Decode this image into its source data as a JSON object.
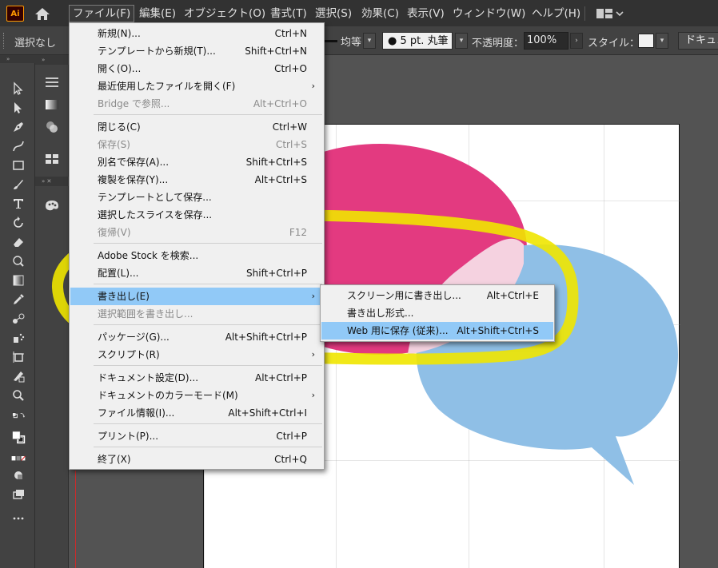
{
  "app": {
    "logo_text": "Ai"
  },
  "menubar": {
    "items": [
      "ファイル(F)",
      "編集(E)",
      "オブジェクト(O)",
      "書式(T)",
      "選択(S)",
      "効果(C)",
      "表示(V)",
      "ウィンドウ(W)",
      "ヘルプ(H)"
    ],
    "workspace_icon": "workspace-switcher-icon"
  },
  "controlbar": {
    "selection_label": "選択なし",
    "stroke_profile": "均等",
    "brush": "● 5 pt. 丸筆",
    "opacity_label": "不透明度：",
    "opacity_value": "100%",
    "style_label": "スタイル：",
    "document_button": "ドキュメ"
  },
  "file_menu": {
    "items": [
      {
        "label": "新規(N)...",
        "shortcut": "Ctrl+N",
        "disabled": false
      },
      {
        "label": "テンプレートから新規(T)...",
        "shortcut": "Shift+Ctrl+N",
        "disabled": false
      },
      {
        "label": "開く(O)...",
        "shortcut": "Ctrl+O",
        "disabled": false
      },
      {
        "label": "最近使用したファイルを開く(F)",
        "shortcut": "",
        "submenu": true,
        "disabled": false
      },
      {
        "label": "Bridge で参照...",
        "shortcut": "Alt+Ctrl+O",
        "disabled": true
      },
      {
        "label": "閉じる(C)",
        "shortcut": "Ctrl+W",
        "disabled": false
      },
      {
        "label": "保存(S)",
        "shortcut": "Ctrl+S",
        "disabled": true
      },
      {
        "label": "別名で保存(A)...",
        "shortcut": "Shift+Ctrl+S",
        "disabled": false
      },
      {
        "label": "複製を保存(Y)...",
        "shortcut": "Alt+Ctrl+S",
        "disabled": false
      },
      {
        "label": "テンプレートとして保存...",
        "shortcut": "",
        "disabled": false
      },
      {
        "label": "選択したスライスを保存...",
        "shortcut": "",
        "disabled": false
      },
      {
        "label": "復帰(V)",
        "shortcut": "F12",
        "disabled": true
      },
      {
        "label": "Adobe Stock を検索...",
        "shortcut": "",
        "disabled": false
      },
      {
        "label": "配置(L)...",
        "shortcut": "Shift+Ctrl+P",
        "disabled": false
      },
      {
        "label": "書き出し(E)",
        "shortcut": "",
        "submenu": true,
        "disabled": false
      },
      {
        "label": "選択範囲を書き出し...",
        "shortcut": "",
        "disabled": true
      },
      {
        "label": "パッケージ(G)...",
        "shortcut": "Alt+Shift+Ctrl+P",
        "disabled": false
      },
      {
        "label": "スクリプト(R)",
        "shortcut": "",
        "submenu": true,
        "disabled": false
      },
      {
        "label": "ドキュメント設定(D)...",
        "shortcut": "Alt+Ctrl+P",
        "disabled": false
      },
      {
        "label": "ドキュメントのカラーモード(M)",
        "shortcut": "",
        "submenu": true,
        "disabled": false
      },
      {
        "label": "ファイル情報(I)...",
        "shortcut": "Alt+Shift+Ctrl+I",
        "disabled": false
      },
      {
        "label": "プリント(P)...",
        "shortcut": "Ctrl+P",
        "disabled": false
      },
      {
        "label": "終了(X)",
        "shortcut": "Ctrl+Q",
        "disabled": false
      }
    ]
  },
  "export_submenu": {
    "items": [
      {
        "label": "スクリーン用に書き出し...",
        "shortcut": "Alt+Ctrl+E"
      },
      {
        "label": "書き出し形式...",
        "shortcut": ""
      },
      {
        "label": "Web 用に保存 (従来)...",
        "shortcut": "Alt+Shift+Ctrl+S"
      }
    ]
  },
  "colors": {
    "pink_bubble": "#e33a80",
    "blue_bubble": "#8fbfe6",
    "highlight": "#91c9f7",
    "annotation": "#f0e600"
  }
}
